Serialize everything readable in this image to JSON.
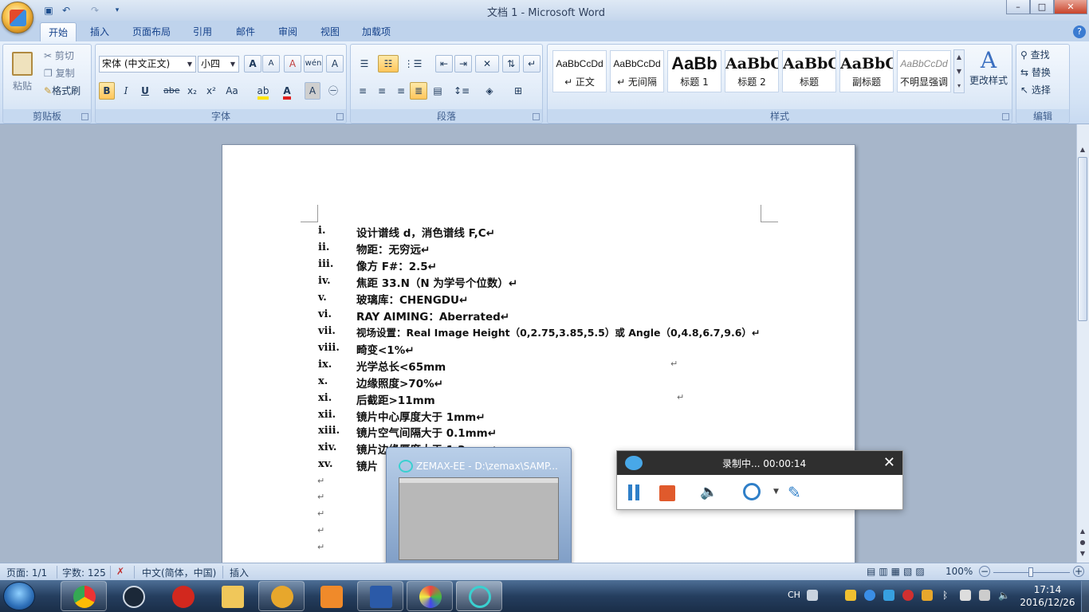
{
  "window": {
    "title": "文档 1 - Microsoft Word",
    "controls": {
      "minimize": "–",
      "maximize": "□",
      "close": "✕"
    }
  },
  "quick_access": {
    "save_icon": "save-icon",
    "undo_icon": "undo-icon",
    "redo_icon": "redo-icon"
  },
  "ribbon": {
    "tabs": [
      "开始",
      "插入",
      "页面布局",
      "引用",
      "邮件",
      "审阅",
      "视图",
      "加载项"
    ],
    "active_tab": "开始",
    "clipboard": {
      "label": "剪贴板",
      "paste": "粘贴",
      "cut": "剪切",
      "copy": "复制",
      "format_painter": "格式刷"
    },
    "font": {
      "label": "字体",
      "font_name": "宋体 (中文正文)",
      "font_size": "小四",
      "bold": "B",
      "italic": "I",
      "underline": "U",
      "strike": "abe",
      "subscript": "x₂",
      "superscript": "x²",
      "change_case": "Aa",
      "grow": "A",
      "shrink": "A",
      "clear": "A",
      "phonetic": "wén",
      "border_char": "A"
    },
    "paragraph": {
      "label": "段落"
    },
    "styles": {
      "label": "样式",
      "items": [
        {
          "sample": "AaBbCcDd",
          "name": "↵ 正文"
        },
        {
          "sample": "AaBbCcDd",
          "name": "↵ 无间隔"
        },
        {
          "sample": "AaBb",
          "name": "标题 1"
        },
        {
          "sample": "AaBbC",
          "name": "标题 2"
        },
        {
          "sample": "AaBbC",
          "name": "标题"
        },
        {
          "sample": "AaBbC",
          "name": "副标题"
        },
        {
          "sample": "AaBbCcDd",
          "name": "不明显强调"
        }
      ],
      "change_styles": "更改样式"
    },
    "editing": {
      "label": "编辑",
      "find": "查找",
      "replace": "替换",
      "select": "选择"
    }
  },
  "document": {
    "items": [
      {
        "num": "i.",
        "text": "设计谱线 d，消色谱线 F,C↵"
      },
      {
        "num": "ii.",
        "text": "物距：无穷远↵"
      },
      {
        "num": "iii.",
        "text": "像方 F#：2.5↵"
      },
      {
        "num": "iv.",
        "text": "焦距 33.N（N 为学号个位数）↵"
      },
      {
        "num": "v.",
        "text": "玻璃库：CHENGDU↵"
      },
      {
        "num": "vi.",
        "text": "RAY AIMING：Aberrated↵"
      },
      {
        "num": "vii.",
        "text": "视场设置：Real Image Height（0,2.75,3.85,5.5）或 Angle（0,4.8,6.7,9.6）↵"
      },
      {
        "num": "viii.",
        "text": "畸变<1%↵"
      },
      {
        "num": "ix.",
        "text": "光学总长<65mm"
      },
      {
        "num": "x.",
        "text": "边缘照度>70%↵"
      },
      {
        "num": "xi.",
        "text": "后截距>11mm"
      },
      {
        "num": "xii.",
        "text": "镜片中心厚度大于 1mm↵"
      },
      {
        "num": "xiii.",
        "text": "镜片空气间隔大于 0.1mm↵"
      },
      {
        "num": "xiv.",
        "text": "镜片边缘厚度大于 1.2mm↵"
      },
      {
        "num": "xv.",
        "text": "镜片"
      }
    ],
    "para_mark": "↵"
  },
  "thumbnail_popup": {
    "title": "ZEMAX-EE - D:\\zemax\\SAMP..."
  },
  "recorder": {
    "status": "录制中... 00:00:14",
    "close": "✕"
  },
  "statusbar": {
    "page": "页面: 1/1",
    "words": "字数: 125",
    "language": "中文(简体，中国)",
    "mode": "插入",
    "zoom": "100%",
    "zoom_minus": "−",
    "zoom_plus": "+"
  },
  "taskbar": {
    "apps": [
      "chrome",
      "steam",
      "netease-music",
      "file-explorer",
      "qq-game",
      "pdf-reader",
      "word",
      "paint",
      "zemax"
    ],
    "tray": {
      "lang": "CH",
      "time": "17:14",
      "date": "2016/12/26"
    }
  },
  "colors": {
    "accent": "#15428b",
    "ribbon_bg": "#d4e3f5",
    "recorder_head": "#2f2f2f"
  }
}
